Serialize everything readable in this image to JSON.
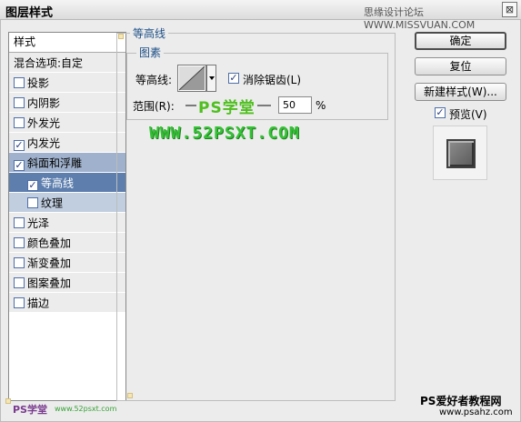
{
  "window": {
    "title": "图层样式",
    "close_glyph": "⊠",
    "top_watermark": "思缘设计论坛 WWW.MISSVUAN.COM"
  },
  "left_panel": {
    "header": "样式",
    "blend_options": "混合选项:自定",
    "items": [
      {
        "label": "投影",
        "checked": false
      },
      {
        "label": "内阴影",
        "checked": false
      },
      {
        "label": "外发光",
        "checked": false
      },
      {
        "label": "内发光",
        "checked": true
      },
      {
        "label": "斜面和浮雕",
        "checked": true,
        "state": "selected-parent"
      },
      {
        "label": "等高线",
        "checked": true,
        "state": "selected",
        "sub": true
      },
      {
        "label": "纹理",
        "checked": false,
        "state": "sub-light",
        "sub": true
      },
      {
        "label": "光泽",
        "checked": false
      },
      {
        "label": "颜色叠加",
        "checked": false
      },
      {
        "label": "渐变叠加",
        "checked": false
      },
      {
        "label": "图案叠加",
        "checked": false
      },
      {
        "label": "描边",
        "checked": false
      }
    ]
  },
  "content": {
    "section_title": "等高线",
    "group_title": "图素",
    "contour_label": "等高线:",
    "anti_alias_label": "消除锯齿(L)",
    "anti_alias_checked": true,
    "range_label": "范围(R):",
    "range_value": "50",
    "range_unit": "%"
  },
  "buttons": {
    "ok": "确定",
    "reset": "复位",
    "new_style": "新建样式(W)...",
    "preview_label": "预览(V)",
    "preview_checked": true
  },
  "watermarks": {
    "ps_xuetang": "PS学堂",
    "site": "WWW.52PSXT.COM",
    "bottom_right": "PS爱好者教程网",
    "bottom_right_url": "www.psahz.com",
    "bottom_left": "PS学堂",
    "bottom_left_url": "www.52psxt.com"
  }
}
